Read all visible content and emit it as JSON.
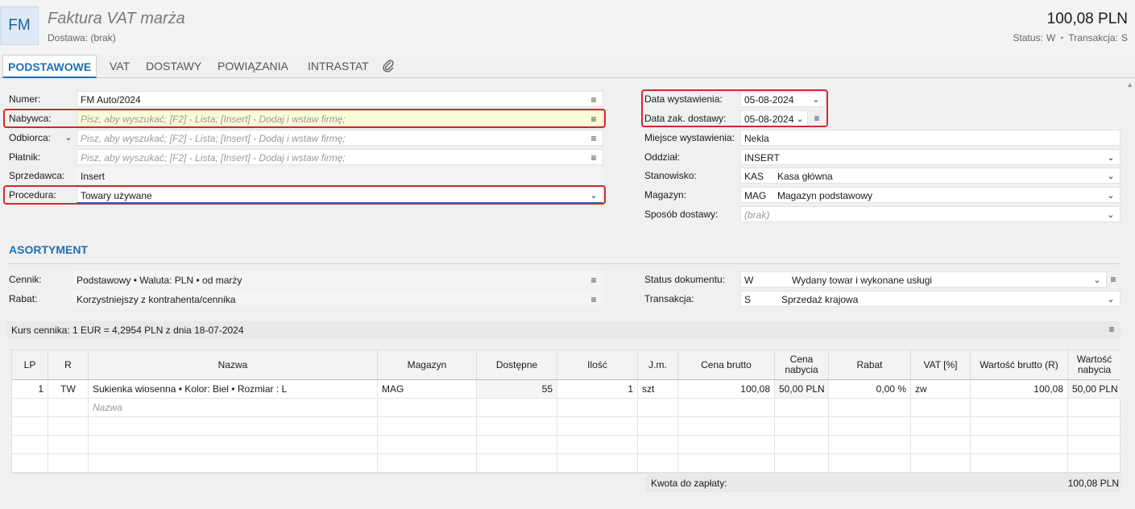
{
  "header": {
    "badge": "FM",
    "title": "Faktura VAT marża",
    "subtitle": "Dostawa: (brak)",
    "amount": "100,08 PLN",
    "status_label": "Status:",
    "status_value": "W",
    "transakcja_label": "Transakcja:",
    "transakcja_value": "S"
  },
  "tabs": [
    "PODSTAWOWE",
    "VAT",
    "DOSTAWY",
    "POWIĄZANIA",
    "INTRASTAT"
  ],
  "left_form": {
    "numer_label": "Numer:",
    "numer_value": "FM Auto/2024",
    "nabywca_label": "Nabywca:",
    "nabywca_placeholder": "Pisz, aby wyszukać; [F2] - Lista; [Insert] - Dodaj i wstaw firmę;",
    "odbiorca_label": "Odbiorca:",
    "odbiorca_placeholder": "Pisz, aby wyszukać; [F2] - Lista; [Insert] - Dodaj i wstaw firmę;",
    "platnik_label": "Płatnik:",
    "platnik_placeholder": "Pisz, aby wyszukać; [F2] - Lista; [Insert] - Dodaj i wstaw firmę;",
    "sprzedawca_label": "Sprzedawca:",
    "sprzedawca_value": "Insert",
    "procedura_label": "Procedura:",
    "procedura_value": "Towary używane"
  },
  "right_form": {
    "data_wyst_label": "Data wystawienia:",
    "data_wyst_value": "05-08-2024",
    "data_zak_label": "Data zak. dostawy:",
    "data_zak_value": "05-08-2024",
    "miejsce_label": "Miejsce wystawienia:",
    "miejsce_value": "Nekla",
    "oddzial_label": "Oddział:",
    "oddzial_value": "INSERT",
    "stanowisko_label": "Stanowisko:",
    "stanowisko_code": "KAS",
    "stanowisko_value": "Kasa główna",
    "magazyn_label": "Magazyn:",
    "magazyn_code": "MAG",
    "magazyn_value": "Magazyn podstawowy",
    "sposob_label": "Sposób dostawy:",
    "sposob_value": "(brak)"
  },
  "asortyment": {
    "title": "ASORTYMENT",
    "cennik_label": "Cennik:",
    "cennik_value": "Podstawowy • Waluta: PLN • od marży",
    "rabat_label": "Rabat:",
    "rabat_value": "Korzystniejszy z kontrahenta/cennika",
    "status_doc_label": "Status dokumentu:",
    "status_doc_code": "W",
    "status_doc_value": "Wydany towar i wykonane usługi",
    "transakcja_label": "Transakcja:",
    "transakcja_code": "S",
    "transakcja_value": "Sprzedaż krajowa",
    "kurs": "Kurs cennika: 1 EUR = 4,2954 PLN z dnia 18-07-2024"
  },
  "grid": {
    "columns": [
      "LP",
      "R",
      "Nazwa",
      "Magazyn",
      "Dostępne",
      "Ilość",
      "J.m.",
      "Cena brutto",
      "Cena nabycia",
      "Rabat",
      "VAT [%]",
      "Wartość brutto (R)",
      "Wartość nabycia"
    ],
    "rows": [
      [
        "1",
        "TW",
        "Sukienka wiosenna • Kolor: Biel • Rozmiar : L",
        "MAG",
        "55",
        "1",
        "szt",
        "100,08",
        "50,00 PLN",
        "0,00 %",
        "zw",
        "100,08",
        "50,00 PLN"
      ]
    ],
    "new_row_placeholder": "Nazwa"
  },
  "footer": {
    "kwota_label": "Kwota do zapłaty:",
    "kwota_value": "100,08 PLN"
  },
  "icons": {
    "menu": "≡",
    "chevron": "⌄",
    "paperclip": "paperclip-icon"
  }
}
